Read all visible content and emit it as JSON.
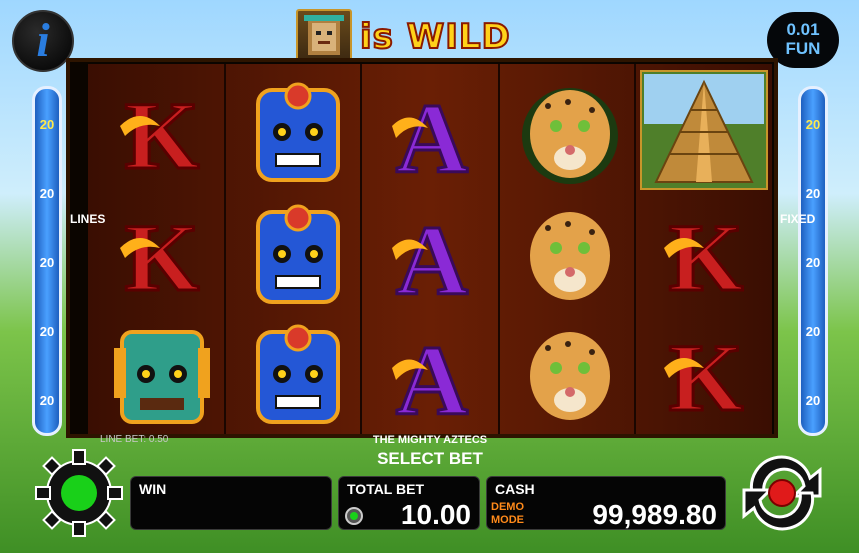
{
  "header": {
    "info_label": "i",
    "title_text": "is WILD",
    "denomination_value": "0.01",
    "denomination_currency": "FUN"
  },
  "lines": {
    "label_left": "LINES",
    "label_right": "FIXED",
    "numbers": [
      "20",
      "20",
      "20",
      "20",
      "20"
    ]
  },
  "reels": [
    [
      "k",
      "mask-blue",
      "a",
      "jaguar",
      "pyramid"
    ],
    [
      "k",
      "mask-blue",
      "a",
      "jaguar",
      "k"
    ],
    [
      "mask-green",
      "mask-blue",
      "a",
      "jaguar",
      "k"
    ]
  ],
  "footer": {
    "line_bet_label": "LINE BET: 0.50",
    "game_name": "THE MIGHTY AZTECS",
    "select_bet_label": "SELECT BET",
    "win_label": "WIN",
    "win_value": "",
    "total_bet_label": "TOTAL BET",
    "total_bet_value": "10.00",
    "cash_label": "CASH",
    "mode_label": "DEMO\nMODE",
    "cash_value": "99,989.80"
  },
  "colors": {
    "accent_gold": "#ffd21a",
    "info_blue": "#2a7de0",
    "panel_bg": "#050505",
    "spin_red": "#e01a1a",
    "settings_green": "#19d019"
  }
}
